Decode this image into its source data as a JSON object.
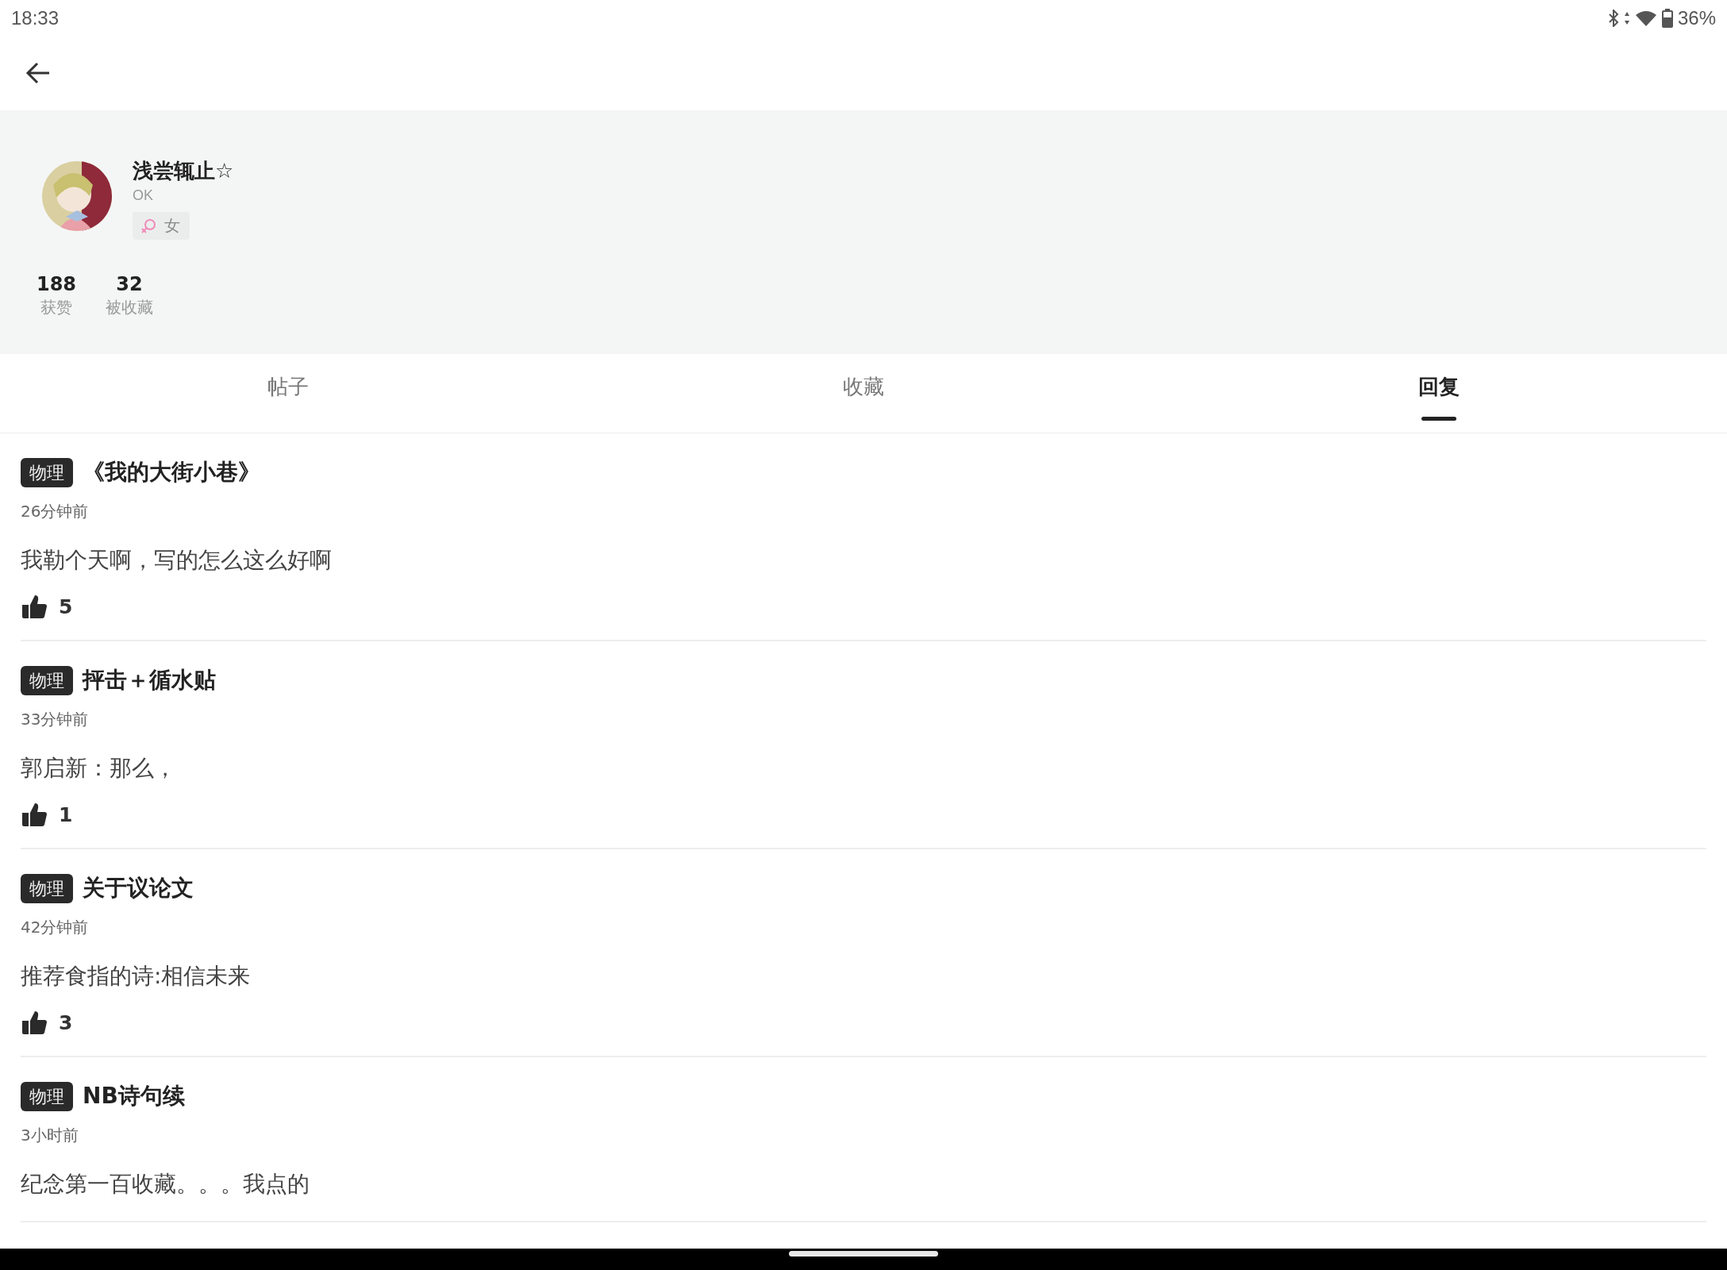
{
  "status_bar": {
    "time": "18:33",
    "battery": "36%"
  },
  "profile": {
    "name": "浅尝辄止☆",
    "bio": "OK",
    "gender": "女",
    "stats": [
      {
        "value": "188",
        "label": "获赞"
      },
      {
        "value": "32",
        "label": "被收藏"
      }
    ]
  },
  "tabs": [
    {
      "label": "帖子",
      "selected": false
    },
    {
      "label": "收藏",
      "selected": false
    },
    {
      "label": "回复",
      "selected": true
    }
  ],
  "replies": [
    {
      "tag": "物理",
      "title": "《我的大街小巷》",
      "time": "26分钟前",
      "text": "我勒个天啊，写的怎么这么好啊",
      "likes": "5"
    },
    {
      "tag": "物理",
      "title": "抨击＋循水贴",
      "time": "33分钟前",
      "text": "郭启新：那么，",
      "likes": "1"
    },
    {
      "tag": "物理",
      "title": "关于议论文",
      "time": "42分钟前",
      "text": "推荐食指的诗:相信未来",
      "likes": "3"
    },
    {
      "tag": "物理",
      "title": "NB诗句续",
      "time": "3小时前",
      "text": "纪念第一百收藏。。。我点的"
    }
  ]
}
